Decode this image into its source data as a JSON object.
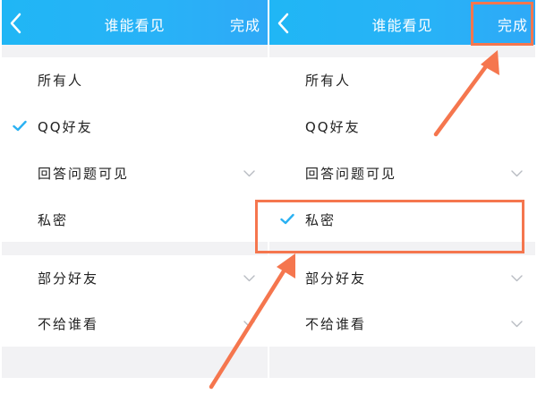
{
  "colors": {
    "header": "#28b2f7",
    "check": "#2ab1f2",
    "annotation": "#f5764e",
    "background": "#f2f2f4"
  },
  "icons": {
    "back": "chevron-left-icon",
    "check": "check-icon",
    "expand": "chevron-down-icon",
    "annotation_arrow": "arrow-icon"
  },
  "panels": [
    {
      "header": {
        "title": "谁能看见",
        "done_label": "完成"
      },
      "options": [
        {
          "label": "所有人",
          "checked": false,
          "expandable": false
        },
        {
          "label": "QQ好友",
          "checked": true,
          "expandable": false
        },
        {
          "label": "回答问题可见",
          "checked": false,
          "expandable": true
        },
        {
          "label": "私密",
          "checked": false,
          "expandable": false
        }
      ],
      "more_options": [
        {
          "label": "部分好友",
          "checked": false,
          "expandable": true
        },
        {
          "label": "不给谁看",
          "checked": false,
          "expandable": true
        }
      ]
    },
    {
      "header": {
        "title": "谁能看见",
        "done_label": "完成"
      },
      "options": [
        {
          "label": "所有人",
          "checked": false,
          "expandable": false
        },
        {
          "label": "QQ好友",
          "checked": false,
          "expandable": false
        },
        {
          "label": "回答问题可见",
          "checked": false,
          "expandable": true
        },
        {
          "label": "私密",
          "checked": true,
          "expandable": false
        }
      ],
      "more_options": [
        {
          "label": "部分好友",
          "checked": false,
          "expandable": true
        },
        {
          "label": "不给谁看",
          "checked": false,
          "expandable": true
        }
      ]
    }
  ]
}
